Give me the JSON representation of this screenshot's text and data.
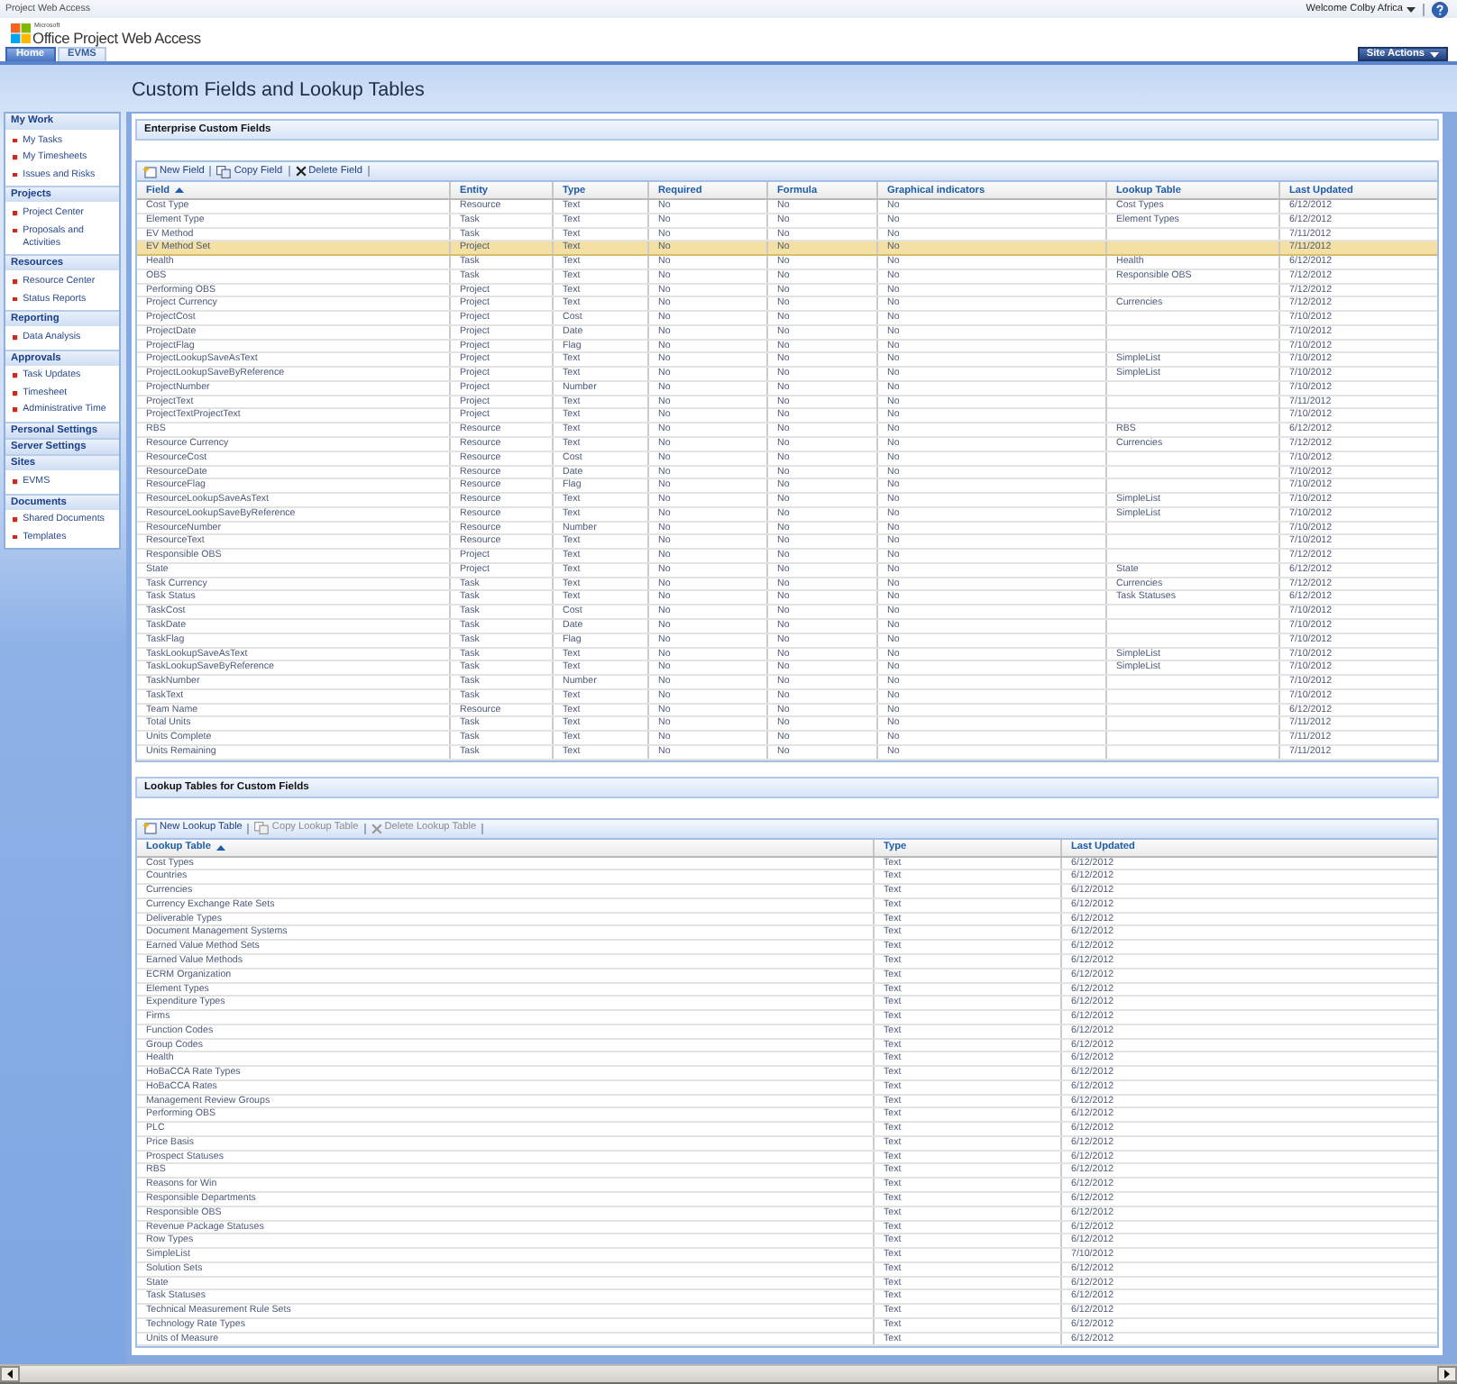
{
  "top_bar": {
    "title": "Project Web Access",
    "user_menu": "Welcome Colby Africa"
  },
  "logo": {
    "small": "Microsoft",
    "text": "Office Project Web Access"
  },
  "tabs": [
    {
      "label": "Home",
      "selected": true
    },
    {
      "label": "EVMS",
      "selected": false
    }
  ],
  "site_actions": {
    "label": "Site Actions"
  },
  "sidebar": {
    "sections": [
      {
        "heading": "My Work",
        "items": [
          "My Tasks",
          "My Timesheets",
          "Issues and Risks"
        ]
      },
      {
        "heading": "Projects",
        "items": [
          "Project Center",
          "Proposals and Activities"
        ]
      },
      {
        "heading": "Resources",
        "items": [
          "Resource Center",
          "Status Reports"
        ]
      },
      {
        "heading": "Reporting",
        "items": [
          "Data Analysis"
        ]
      },
      {
        "heading": "Approvals",
        "items": [
          "Task Updates",
          "Timesheet",
          "Administrative Time"
        ]
      },
      {
        "heading": "Personal Settings"
      },
      {
        "heading": "Server Settings"
      },
      {
        "heading": "Sites",
        "items": [
          "EVMS"
        ]
      },
      {
        "heading": "Documents",
        "items": [
          "Shared Documents",
          "Templates"
        ]
      }
    ]
  },
  "page_title": "Custom Fields and Lookup Tables",
  "custom_fields": {
    "heading": "Enterprise Custom Fields",
    "toolbar": [
      {
        "kind": "new",
        "label": "New Field",
        "disabled": false
      },
      {
        "kind": "copy",
        "label": "Copy Field",
        "disabled": false
      },
      {
        "kind": "delete",
        "label": "Delete Field",
        "disabled": false
      }
    ],
    "columns": [
      {
        "label": "Field",
        "sorted": true
      },
      {
        "label": "Entity",
        "sorted": false
      },
      {
        "label": "Type",
        "sorted": false
      },
      {
        "label": "Required",
        "sorted": false
      },
      {
        "label": "Formula",
        "sorted": false
      },
      {
        "label": "Graphical indicators",
        "sorted": false
      },
      {
        "label": "Lookup Table",
        "sorted": false
      },
      {
        "label": "Last Updated",
        "sorted": false
      }
    ],
    "rows": [
      {
        "field": "Cost Type",
        "entity": "Resource",
        "type": "Text",
        "required": "No",
        "formula": "No",
        "graphical_indicators": "No",
        "lookup_table": "Cost Types",
        "last_updated": "6/12/2012",
        "selected": false
      },
      {
        "field": "Element Type",
        "entity": "Task",
        "type": "Text",
        "required": "No",
        "formula": "No",
        "graphical_indicators": "No",
        "lookup_table": "Element Types",
        "last_updated": "6/12/2012",
        "selected": false
      },
      {
        "field": "EV Method",
        "entity": "Task",
        "type": "Text",
        "required": "No",
        "formula": "No",
        "graphical_indicators": "No",
        "last_updated": "7/11/2012",
        "selected": false
      },
      {
        "field": "EV Method Set",
        "entity": "Project",
        "type": "Text",
        "required": "No",
        "formula": "No",
        "graphical_indicators": "No",
        "last_updated": "7/11/2012",
        "selected": true
      },
      {
        "field": "Health",
        "entity": "Task",
        "type": "Text",
        "required": "No",
        "formula": "No",
        "graphical_indicators": "No",
        "lookup_table": "Health",
        "last_updated": "6/12/2012",
        "selected": false
      },
      {
        "field": "OBS",
        "entity": "Task",
        "type": "Text",
        "required": "No",
        "formula": "No",
        "graphical_indicators": "No",
        "lookup_table": "Responsible OBS",
        "last_updated": "7/12/2012",
        "selected": false
      },
      {
        "field": "Performing OBS",
        "entity": "Project",
        "type": "Text",
        "required": "No",
        "formula": "No",
        "graphical_indicators": "No",
        "last_updated": "7/12/2012",
        "selected": false
      },
      {
        "field": "Project Currency",
        "entity": "Project",
        "type": "Text",
        "required": "No",
        "formula": "No",
        "graphical_indicators": "No",
        "lookup_table": "Currencies",
        "last_updated": "7/12/2012",
        "selected": false
      },
      {
        "field": "ProjectCost",
        "entity": "Project",
        "type": "Cost",
        "required": "No",
        "formula": "No",
        "graphical_indicators": "No",
        "last_updated": "7/10/2012",
        "selected": false
      },
      {
        "field": "ProjectDate",
        "entity": "Project",
        "type": "Date",
        "required": "No",
        "formula": "No",
        "graphical_indicators": "No",
        "last_updated": "7/10/2012",
        "selected": false
      },
      {
        "field": "ProjectFlag",
        "entity": "Project",
        "type": "Flag",
        "required": "No",
        "formula": "No",
        "graphical_indicators": "No",
        "last_updated": "7/10/2012",
        "selected": false
      },
      {
        "field": "ProjectLookupSaveAsText",
        "entity": "Project",
        "type": "Text",
        "required": "No",
        "formula": "No",
        "graphical_indicators": "No",
        "lookup_table": "SimpleList",
        "last_updated": "7/10/2012",
        "selected": false
      },
      {
        "field": "ProjectLookupSaveByReference",
        "entity": "Project",
        "type": "Text",
        "required": "No",
        "formula": "No",
        "graphical_indicators": "No",
        "lookup_table": "SimpleList",
        "last_updated": "7/10/2012",
        "selected": false
      },
      {
        "field": "ProjectNumber",
        "entity": "Project",
        "type": "Number",
        "required": "No",
        "formula": "No",
        "graphical_indicators": "No",
        "last_updated": "7/10/2012",
        "selected": false
      },
      {
        "field": "ProjectText",
        "entity": "Project",
        "type": "Text",
        "required": "No",
        "formula": "No",
        "graphical_indicators": "No",
        "last_updated": "7/11/2012",
        "selected": false
      },
      {
        "field": "ProjectTextProjectText",
        "entity": "Project",
        "type": "Text",
        "required": "No",
        "formula": "No",
        "graphical_indicators": "No",
        "last_updated": "7/10/2012",
        "selected": false
      },
      {
        "field": "RBS",
        "entity": "Resource",
        "type": "Text",
        "required": "No",
        "formula": "No",
        "graphical_indicators": "No",
        "lookup_table": "RBS",
        "last_updated": "6/12/2012",
        "selected": false
      },
      {
        "field": "Resource Currency",
        "entity": "Resource",
        "type": "Text",
        "required": "No",
        "formula": "No",
        "graphical_indicators": "No",
        "lookup_table": "Currencies",
        "last_updated": "7/12/2012",
        "selected": false
      },
      {
        "field": "ResourceCost",
        "entity": "Resource",
        "type": "Cost",
        "required": "No",
        "formula": "No",
        "graphical_indicators": "No",
        "last_updated": "7/10/2012",
        "selected": false
      },
      {
        "field": "ResourceDate",
        "entity": "Resource",
        "type": "Date",
        "required": "No",
        "formula": "No",
        "graphical_indicators": "No",
        "last_updated": "7/10/2012",
        "selected": false
      },
      {
        "field": "ResourceFlag",
        "entity": "Resource",
        "type": "Flag",
        "required": "No",
        "formula": "No",
        "graphical_indicators": "No",
        "last_updated": "7/10/2012",
        "selected": false
      },
      {
        "field": "ResourceLookupSaveAsText",
        "entity": "Resource",
        "type": "Text",
        "required": "No",
        "formula": "No",
        "graphical_indicators": "No",
        "lookup_table": "SimpleList",
        "last_updated": "7/10/2012",
        "selected": false
      },
      {
        "field": "ResourceLookupSaveByReference",
        "entity": "Resource",
        "type": "Text",
        "required": "No",
        "formula": "No",
        "graphical_indicators": "No",
        "lookup_table": "SimpleList",
        "last_updated": "7/10/2012",
        "selected": false
      },
      {
        "field": "ResourceNumber",
        "entity": "Resource",
        "type": "Number",
        "required": "No",
        "formula": "No",
        "graphical_indicators": "No",
        "last_updated": "7/10/2012",
        "selected": false
      },
      {
        "field": "ResourceText",
        "entity": "Resource",
        "type": "Text",
        "required": "No",
        "formula": "No",
        "graphical_indicators": "No",
        "last_updated": "7/10/2012",
        "selected": false
      },
      {
        "field": "Responsible OBS",
        "entity": "Project",
        "type": "Text",
        "required": "No",
        "formula": "No",
        "graphical_indicators": "No",
        "last_updated": "7/12/2012",
        "selected": false
      },
      {
        "field": "State",
        "entity": "Project",
        "type": "Text",
        "required": "No",
        "formula": "No",
        "graphical_indicators": "No",
        "lookup_table": "State",
        "last_updated": "6/12/2012",
        "selected": false
      },
      {
        "field": "Task Currency",
        "entity": "Task",
        "type": "Text",
        "required": "No",
        "formula": "No",
        "graphical_indicators": "No",
        "lookup_table": "Currencies",
        "last_updated": "7/12/2012",
        "selected": false
      },
      {
        "field": "Task Status",
        "entity": "Task",
        "type": "Text",
        "required": "No",
        "formula": "No",
        "graphical_indicators": "No",
        "lookup_table": "Task Statuses",
        "last_updated": "6/12/2012",
        "selected": false
      },
      {
        "field": "TaskCost",
        "entity": "Task",
        "type": "Cost",
        "required": "No",
        "formula": "No",
        "graphical_indicators": "No",
        "last_updated": "7/10/2012",
        "selected": false
      },
      {
        "field": "TaskDate",
        "entity": "Task",
        "type": "Date",
        "required": "No",
        "formula": "No",
        "graphical_indicators": "No",
        "last_updated": "7/10/2012",
        "selected": false
      },
      {
        "field": "TaskFlag",
        "entity": "Task",
        "type": "Flag",
        "required": "No",
        "formula": "No",
        "graphical_indicators": "No",
        "last_updated": "7/10/2012",
        "selected": false
      },
      {
        "field": "TaskLookupSaveAsText",
        "entity": "Task",
        "type": "Text",
        "required": "No",
        "formula": "No",
        "graphical_indicators": "No",
        "lookup_table": "SimpleList",
        "last_updated": "7/10/2012",
        "selected": false
      },
      {
        "field": "TaskLookupSaveByReference",
        "entity": "Task",
        "type": "Text",
        "required": "No",
        "formula": "No",
        "graphical_indicators": "No",
        "lookup_table": "SimpleList",
        "last_updated": "7/10/2012",
        "selected": false
      },
      {
        "field": "TaskNumber",
        "entity": "Task",
        "type": "Number",
        "required": "No",
        "formula": "No",
        "graphical_indicators": "No",
        "last_updated": "7/10/2012",
        "selected": false
      },
      {
        "field": "TaskText",
        "entity": "Task",
        "type": "Text",
        "required": "No",
        "formula": "No",
        "graphical_indicators": "No",
        "last_updated": "7/10/2012",
        "selected": false
      },
      {
        "field": "Team Name",
        "entity": "Resource",
        "type": "Text",
        "required": "No",
        "formula": "No",
        "graphical_indicators": "No",
        "last_updated": "6/12/2012",
        "selected": false
      },
      {
        "field": "Total Units",
        "entity": "Task",
        "type": "Text",
        "required": "No",
        "formula": "No",
        "graphical_indicators": "No",
        "last_updated": "7/11/2012",
        "selected": false
      },
      {
        "field": "Units Complete",
        "entity": "Task",
        "type": "Text",
        "required": "No",
        "formula": "No",
        "graphical_indicators": "No",
        "last_updated": "7/11/2012",
        "selected": false
      },
      {
        "field": "Units Remaining",
        "entity": "Task",
        "type": "Text",
        "required": "No",
        "formula": "No",
        "graphical_indicators": "No",
        "last_updated": "7/11/2012",
        "selected": false
      }
    ]
  },
  "lookup_tables": {
    "heading": "Lookup Tables for Custom Fields",
    "toolbar": [
      {
        "kind": "new",
        "label": "New Lookup Table",
        "disabled": false
      },
      {
        "kind": "copy",
        "label": "Copy Lookup Table",
        "disabled": true
      },
      {
        "kind": "delete",
        "label": "Delete Lookup Table",
        "disabled": true
      }
    ],
    "columns": [
      {
        "label": "Lookup Table",
        "sorted": true
      },
      {
        "label": "Type",
        "sorted": false
      },
      {
        "label": "Last Updated",
        "sorted": false
      }
    ],
    "rows": [
      {
        "name": "Cost Types",
        "type": "Text",
        "last_updated": "6/12/2012",
        "selected": false
      },
      {
        "name": "Countries",
        "type": "Text",
        "last_updated": "6/12/2012",
        "selected": false
      },
      {
        "name": "Currencies",
        "type": "Text",
        "last_updated": "6/12/2012",
        "selected": false
      },
      {
        "name": "Currency Exchange Rate Sets",
        "type": "Text",
        "last_updated": "6/12/2012",
        "selected": false
      },
      {
        "name": "Deliverable Types",
        "type": "Text",
        "last_updated": "6/12/2012",
        "selected": false
      },
      {
        "name": "Document Management Systems",
        "type": "Text",
        "last_updated": "6/12/2012",
        "selected": false
      },
      {
        "name": "Earned Value Method Sets",
        "type": "Text",
        "last_updated": "6/12/2012",
        "selected": false
      },
      {
        "name": "Earned Value Methods",
        "type": "Text",
        "last_updated": "6/12/2012",
        "selected": false
      },
      {
        "name": "ECRM Organization",
        "type": "Text",
        "last_updated": "6/12/2012",
        "selected": false
      },
      {
        "name": "Element Types",
        "type": "Text",
        "last_updated": "6/12/2012",
        "selected": false
      },
      {
        "name": "Expenditure Types",
        "type": "Text",
        "last_updated": "6/12/2012",
        "selected": false
      },
      {
        "name": "Firms",
        "type": "Text",
        "last_updated": "6/12/2012",
        "selected": false
      },
      {
        "name": "Function Codes",
        "type": "Text",
        "last_updated": "6/12/2012",
        "selected": false
      },
      {
        "name": "Group Codes",
        "type": "Text",
        "last_updated": "6/12/2012",
        "selected": false
      },
      {
        "name": "Health",
        "type": "Text",
        "last_updated": "6/12/2012",
        "selected": false
      },
      {
        "name": "HoBaCCA Rate Types",
        "type": "Text",
        "last_updated": "6/12/2012",
        "selected": false
      },
      {
        "name": "HoBaCCA Rates",
        "type": "Text",
        "last_updated": "6/12/2012",
        "selected": false
      },
      {
        "name": "Management Review Groups",
        "type": "Text",
        "last_updated": "6/12/2012",
        "selected": false
      },
      {
        "name": "Performing OBS",
        "type": "Text",
        "last_updated": "6/12/2012",
        "selected": false
      },
      {
        "name": "PLC",
        "type": "Text",
        "last_updated": "6/12/2012",
        "selected": false
      },
      {
        "name": "Price Basis",
        "type": "Text",
        "last_updated": "6/12/2012",
        "selected": false
      },
      {
        "name": "Prospect Statuses",
        "type": "Text",
        "last_updated": "6/12/2012",
        "selected": false
      },
      {
        "name": "RBS",
        "type": "Text",
        "last_updated": "6/12/2012",
        "selected": false
      },
      {
        "name": "Reasons for Win",
        "type": "Text",
        "last_updated": "6/12/2012",
        "selected": false
      },
      {
        "name": "Responsible Departments",
        "type": "Text",
        "last_updated": "6/12/2012",
        "selected": false
      },
      {
        "name": "Responsible OBS",
        "type": "Text",
        "last_updated": "6/12/2012",
        "selected": false
      },
      {
        "name": "Revenue Package Statuses",
        "type": "Text",
        "last_updated": "6/12/2012",
        "selected": false
      },
      {
        "name": "Row Types",
        "type": "Text",
        "last_updated": "6/12/2012",
        "selected": false
      },
      {
        "name": "SimpleList",
        "type": "Text",
        "last_updated": "7/10/2012",
        "selected": false
      },
      {
        "name": "Solution Sets",
        "type": "Text",
        "last_updated": "6/12/2012",
        "selected": false
      },
      {
        "name": "State",
        "type": "Text",
        "last_updated": "6/12/2012",
        "selected": false
      },
      {
        "name": "Task Statuses",
        "type": "Text",
        "last_updated": "6/12/2012",
        "selected": false
      },
      {
        "name": "Technical Measurement Rule Sets",
        "type": "Text",
        "last_updated": "6/12/2012",
        "selected": false
      },
      {
        "name": "Technology Rate Types",
        "type": "Text",
        "last_updated": "6/12/2012",
        "selected": false
      },
      {
        "name": "Units of Measure",
        "type": "Text",
        "last_updated": "6/12/2012",
        "selected": false
      }
    ]
  }
}
